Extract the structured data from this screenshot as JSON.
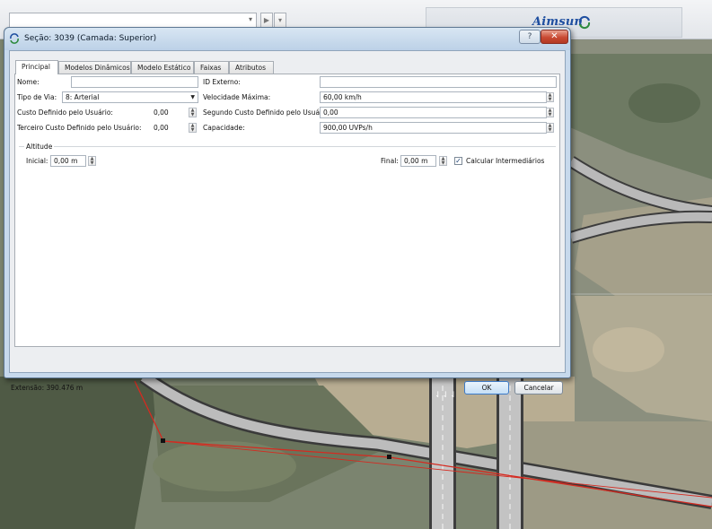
{
  "app": {
    "logo_text": "Aimsun",
    "toolbar": {
      "combo_value": ""
    }
  },
  "dialog": {
    "title": "Seção: 3039 (Camada: Superior)",
    "tabs": [
      {
        "label": "Principal",
        "active": true
      },
      {
        "label": "Modelos Dinâmicos",
        "active": false
      },
      {
        "label": "Modelo Estático",
        "active": false
      },
      {
        "label": "Faixas",
        "active": false
      },
      {
        "label": "Atributos",
        "active": false
      }
    ],
    "fields": {
      "nome": {
        "label": "Nome:",
        "value": ""
      },
      "id_externo": {
        "label": "ID Externo:",
        "value": ""
      },
      "tipo_via": {
        "label": "Tipo de Via:",
        "value": "8: Arterial"
      },
      "velocidade_maxima": {
        "label": "Velocidade Máxima:",
        "value": "60,00 km/h"
      },
      "custo_usuario": {
        "label": "Custo Definido pelo Usuário:",
        "value": "0,00"
      },
      "segundo_custo": {
        "label": "Segundo Custo Definido pelo Usuário:",
        "value": "0,00"
      },
      "terceiro_custo": {
        "label": "Terceiro Custo Definido pelo Usuário:",
        "value": "0,00"
      },
      "capacidade": {
        "label": "Capacidade:",
        "value": "900,00 UVPs/h"
      }
    },
    "altitude": {
      "group_label": "Altitude",
      "inicial_label": "Inicial:",
      "inicial_value": "0,00 m",
      "final_label": "Final:",
      "final_value": "0,00 m",
      "calcular_label": "Calcular Intermediários",
      "calcular_checked": true
    },
    "extensao": "Extensão: 390.476 m",
    "ok_label": "OK",
    "cancel_label": "Cancelar"
  },
  "map_lane_arrows": "⇃⇃⇃"
}
